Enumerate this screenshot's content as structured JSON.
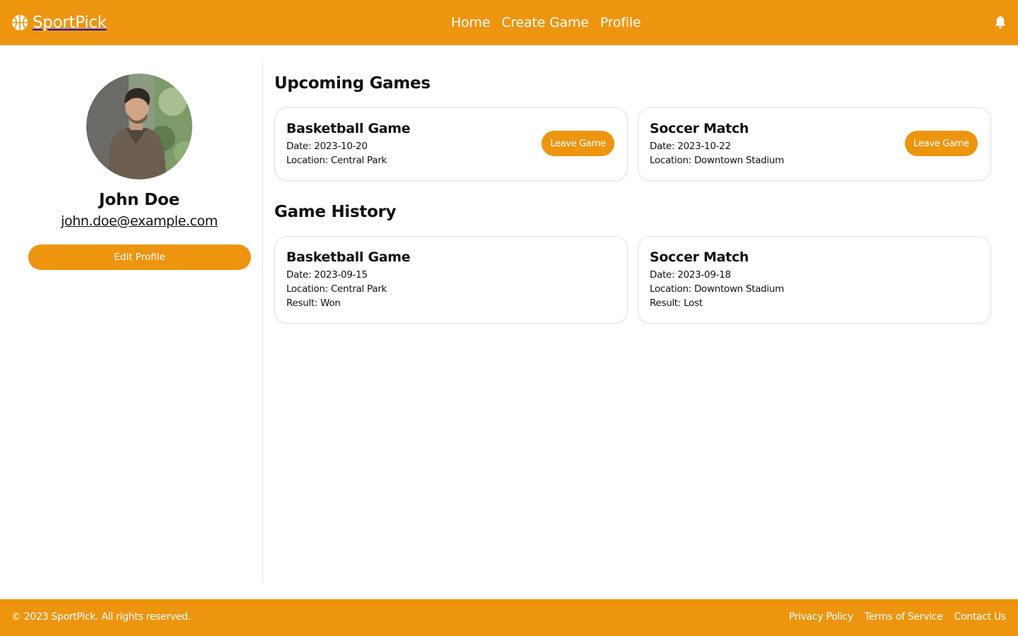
{
  "colors": {
    "accent": "#ED950E",
    "text": "#111111",
    "background": "#FFFFFF"
  },
  "header": {
    "brand_icon": "basketball-icon",
    "brand_name": "SportPick",
    "nav": [
      "Home",
      "Create Game",
      "Profile"
    ],
    "notification_icon": "bell-icon"
  },
  "profile": {
    "avatar": "profile-photo",
    "name": "John Doe",
    "email": "john.doe@example.com",
    "edit_label": "Edit Profile"
  },
  "upcoming": {
    "title": "Upcoming Games",
    "games": [
      {
        "title": "Basketball Game",
        "date": "Date: 2023-10-20",
        "location": "Location: Central Park",
        "action": "Leave Game"
      },
      {
        "title": "Soccer Match",
        "date": "Date: 2023-10-22",
        "location": "Location: Downtown Stadium",
        "action": "Leave Game"
      }
    ]
  },
  "history": {
    "title": "Game History",
    "games": [
      {
        "title": "Basketball Game",
        "date": "Date: 2023-09-15",
        "location": "Location: Central Park",
        "result": "Result: Won"
      },
      {
        "title": "Soccer Match",
        "date": "Date: 2023-09-18",
        "location": "Location: Downtown Stadium",
        "result": "Result: Lost"
      }
    ]
  },
  "footer": {
    "copyright": "© 2023 SportPick. All rights reserved.",
    "links": [
      "Privacy Policy",
      "Terms of Service",
      "Contact Us"
    ]
  }
}
